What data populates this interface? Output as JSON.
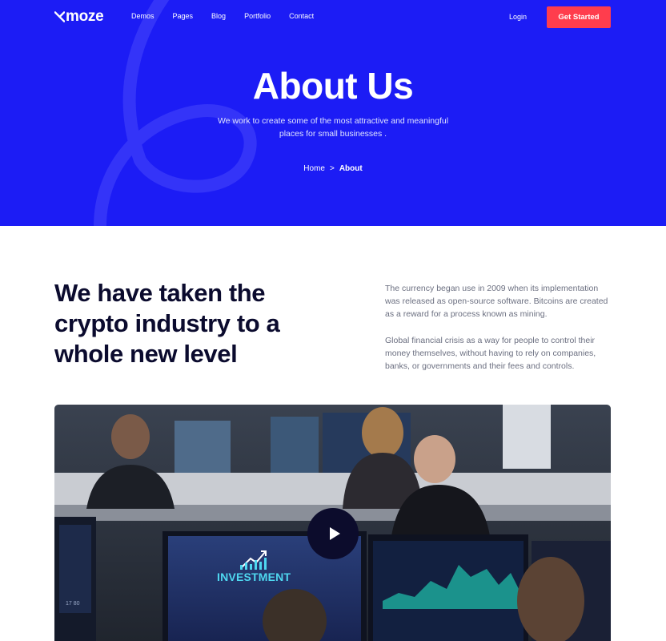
{
  "nav": {
    "logo": "moze",
    "links": [
      "Demos",
      "Pages",
      "Blog",
      "Portfolio",
      "Contact"
    ],
    "login": "Login",
    "cta": "Get Started"
  },
  "hero": {
    "title": "About Us",
    "subtitle": "We work to create some of the most attractive and meaningful places for small businesses .",
    "breadcrumb": {
      "home": "Home",
      "separator": ">",
      "current": "About"
    }
  },
  "intro": {
    "headline": "We have taken the crypto industry to a whole new level",
    "paragraphs": [
      "The currency began use in 2009 when its implementation was released as open-source software. Bitcoins are created as a reward for a process known as mining.",
      "Global financial crisis as a way for people to control their money themselves, without having to rely on companies, banks, or governments and their fees and controls."
    ]
  },
  "media": {
    "screen_text": "INVESTMENT",
    "screen_number": "17 80",
    "play_icon": "play-icon"
  },
  "colors": {
    "hero_bg": "#1c1cf5",
    "cta_bg": "#ff3d4d",
    "heading": "#0b0b2e",
    "body_text": "#6b6f80"
  }
}
